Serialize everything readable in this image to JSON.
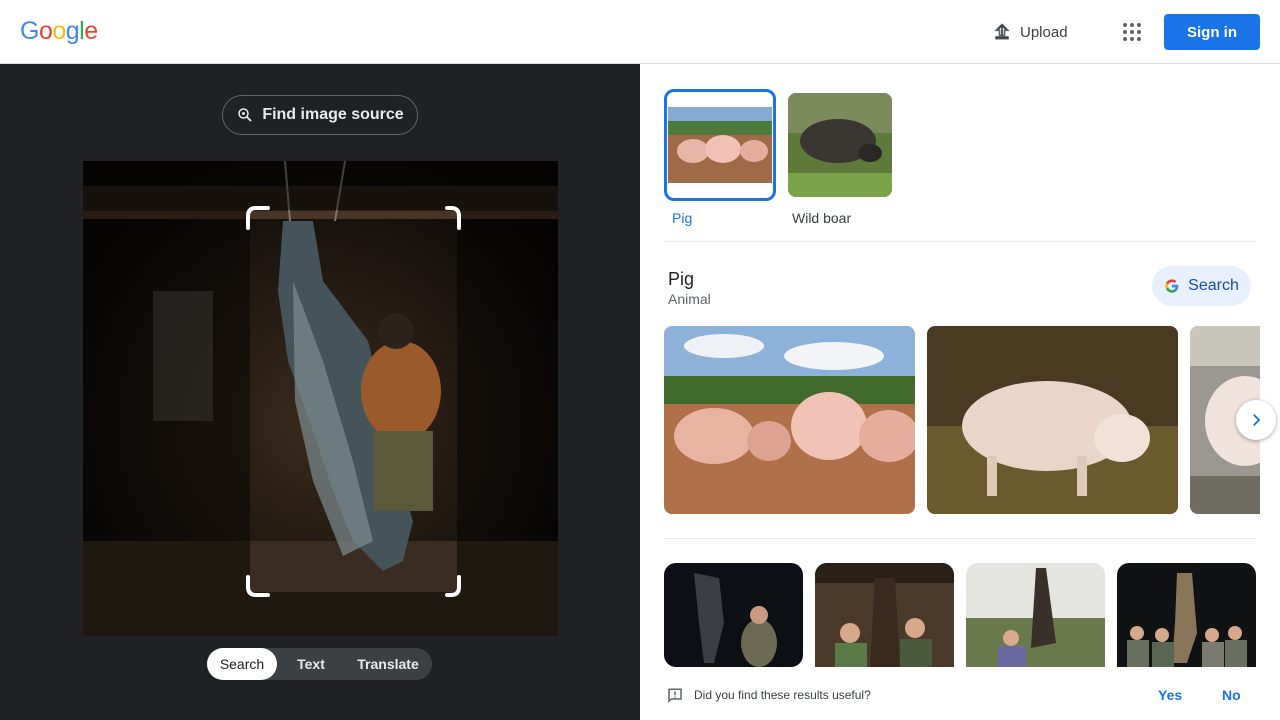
{
  "header": {
    "logo_letters": [
      "G",
      "o",
      "o",
      "g",
      "l",
      "e"
    ],
    "logo_colors": [
      "#4285f4",
      "#ea4335",
      "#fbbc05",
      "#4285f4",
      "#34a853",
      "#ea4335"
    ],
    "upload_label": "Upload",
    "apps_icon": "apps-grid-icon",
    "signin_label": "Sign in"
  },
  "left": {
    "find_source_label": "Find image source",
    "modes": [
      {
        "label": "Search",
        "active": true
      },
      {
        "label": "Text",
        "active": false
      },
      {
        "label": "Translate",
        "active": false
      }
    ]
  },
  "right": {
    "chips": [
      {
        "label": "Pig",
        "selected": true
      },
      {
        "label": "Wild boar",
        "selected": false
      }
    ],
    "entity": {
      "title": "Pig",
      "subtitle": "Animal",
      "search_label": "Search"
    },
    "feedback": {
      "question": "Did you find these results useful?",
      "yes": "Yes",
      "no": "No"
    }
  },
  "colors": {
    "accent": "#1a73e8",
    "left_panel_bg": "#202124",
    "search_chip_bg": "#e8f0fe"
  }
}
